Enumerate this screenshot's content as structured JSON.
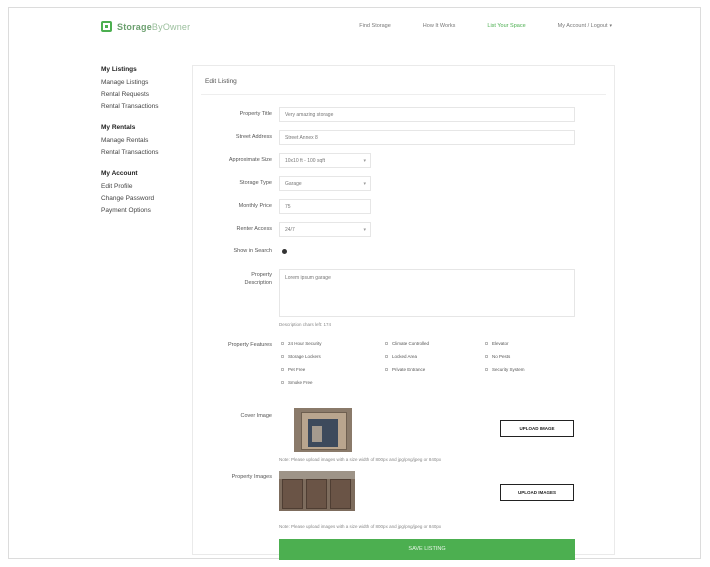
{
  "logo": {
    "part1": "Storage",
    "part2": "ByOwner"
  },
  "topnav": [
    {
      "label": "Find Storage"
    },
    {
      "label": "How It Works"
    },
    {
      "label": "List Your Space"
    },
    {
      "label": "My Account / Logout"
    }
  ],
  "sidebar": [
    {
      "heading": "My Listings",
      "items": [
        "Manage Listings",
        "Rental Requests",
        "Rental Transactions"
      ]
    },
    {
      "heading": "My Rentals",
      "items": [
        "Manage Rentals",
        "Rental Transactions"
      ]
    },
    {
      "heading": "My Account",
      "items": [
        "Edit Profile",
        "Change Password",
        "Payment Options"
      ]
    }
  ],
  "form": {
    "title": "Edit Listing",
    "labels": {
      "title": "Property Title",
      "street": "Street Address",
      "size": "Approximate Size",
      "type": "Storage Type",
      "monthly": "Monthly Price",
      "access": "Renter Access",
      "search": "Show in Search",
      "desc1": "Property",
      "desc2": "Description",
      "features": "Property Features",
      "cover": "Cover Image",
      "images": "Property Images"
    },
    "values": {
      "title": "Very amazing storage",
      "street": "Street Annex 8",
      "size": "10x10 ft - 100 sqft",
      "type": "Garage",
      "monthly": "75",
      "access": "24/7",
      "desc": "Lorem ipsum garage"
    },
    "chars_remaining": "Description chars left: 174",
    "features": [
      "24 Hour Security",
      "Climate Controlled",
      "Elevator",
      "Storage Lockers",
      "Locked Area",
      "No Pests",
      "Pet Free",
      "Private Entrance",
      "Security System",
      "Smoke Free"
    ],
    "cover_button": "UPLOAD IMAGE",
    "images_button": "UPLOAD IMAGES",
    "image_note": "Note: Please upload images with a size width of 800px and jpg/png/jpeg or 840px",
    "submit_label": "SAVE LISTING"
  }
}
